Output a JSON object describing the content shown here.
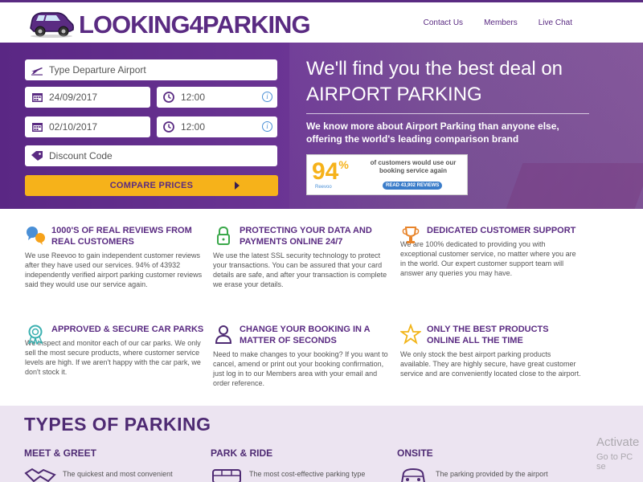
{
  "header": {
    "logo_text": "LOOKING4PARKING",
    "nav": [
      "Contact Us",
      "Members",
      "Live Chat"
    ]
  },
  "form": {
    "departure_placeholder": "Type Departure Airport",
    "depart_date": "24/09/2017",
    "depart_time": "12:00",
    "return_date": "02/10/2017",
    "return_time": "12:00",
    "discount_placeholder": "Discount Code",
    "compare_label": "COMPARE PRICES"
  },
  "hero": {
    "title_line1": "We'll find you the best deal on",
    "title_line2": "AIRPORT PARKING",
    "subtitle": "We know more about Airport Parking than anyone else, offering the world's leading comparison brand"
  },
  "reevoo": {
    "percent": "94",
    "percent_sign": "%",
    "brand": "Reevoo",
    "description": "of customers would use our booking service again",
    "read_label": "READ 43,902 REVIEWS"
  },
  "features": [
    {
      "title": "1000'S OF REAL REVIEWS FROM REAL CUSTOMERS",
      "text": "We use Reevoo to gain independent customer reviews after they have used our services. 94% of 43932 independently verified airport parking customer reviews said they would use our service again."
    },
    {
      "title": "PROTECTING YOUR DATA AND PAYMENTS ONLINE 24/7",
      "text": "We use the latest SSL security technology to protect your transactions. You can be assured that your card details are safe, and after your transaction is complete we erase your details."
    },
    {
      "title": "DEDICATED CUSTOMER SUPPORT",
      "text": "We are 100% dedicated to providing you with exceptional customer service, no matter where you are in the world. Our expert customer support team will answer any queries you may have."
    },
    {
      "title": "APPROVED & SECURE CAR PARKS",
      "text": "We inspect and monitor each of our car parks. We only sell the most secure products, where customer service levels are high. If we aren't happy with the car park, we don't stock it."
    },
    {
      "title": "CHANGE YOUR BOOKING IN A MATTER OF SECONDS",
      "text": "Need to make changes to your booking? If you want to cancel, amend or print out your booking confirmation, just log in to our Members area with your email and order reference."
    },
    {
      "title": "ONLY THE BEST PRODUCTS ONLINE ALL THE TIME",
      "text": "We only stock the best airport parking products available. They are highly secure, have great customer service and are conveniently located close to the airport."
    }
  ],
  "types": {
    "heading": "TYPES OF PARKING",
    "items": [
      {
        "title": "MEET & GREET",
        "text": "The quickest and most convenient"
      },
      {
        "title": "PARK & RIDE",
        "text": "The most cost-effective parking type"
      },
      {
        "title": "ONSITE",
        "text": "The parking provided by the airport"
      }
    ]
  },
  "watermark": {
    "line1": "Activate",
    "line2": "Go to PC se"
  },
  "colors": {
    "brand_purple": "#5a2b82",
    "accent_yellow": "#f6b21a",
    "reevoo_blue": "#3a7cc9"
  }
}
